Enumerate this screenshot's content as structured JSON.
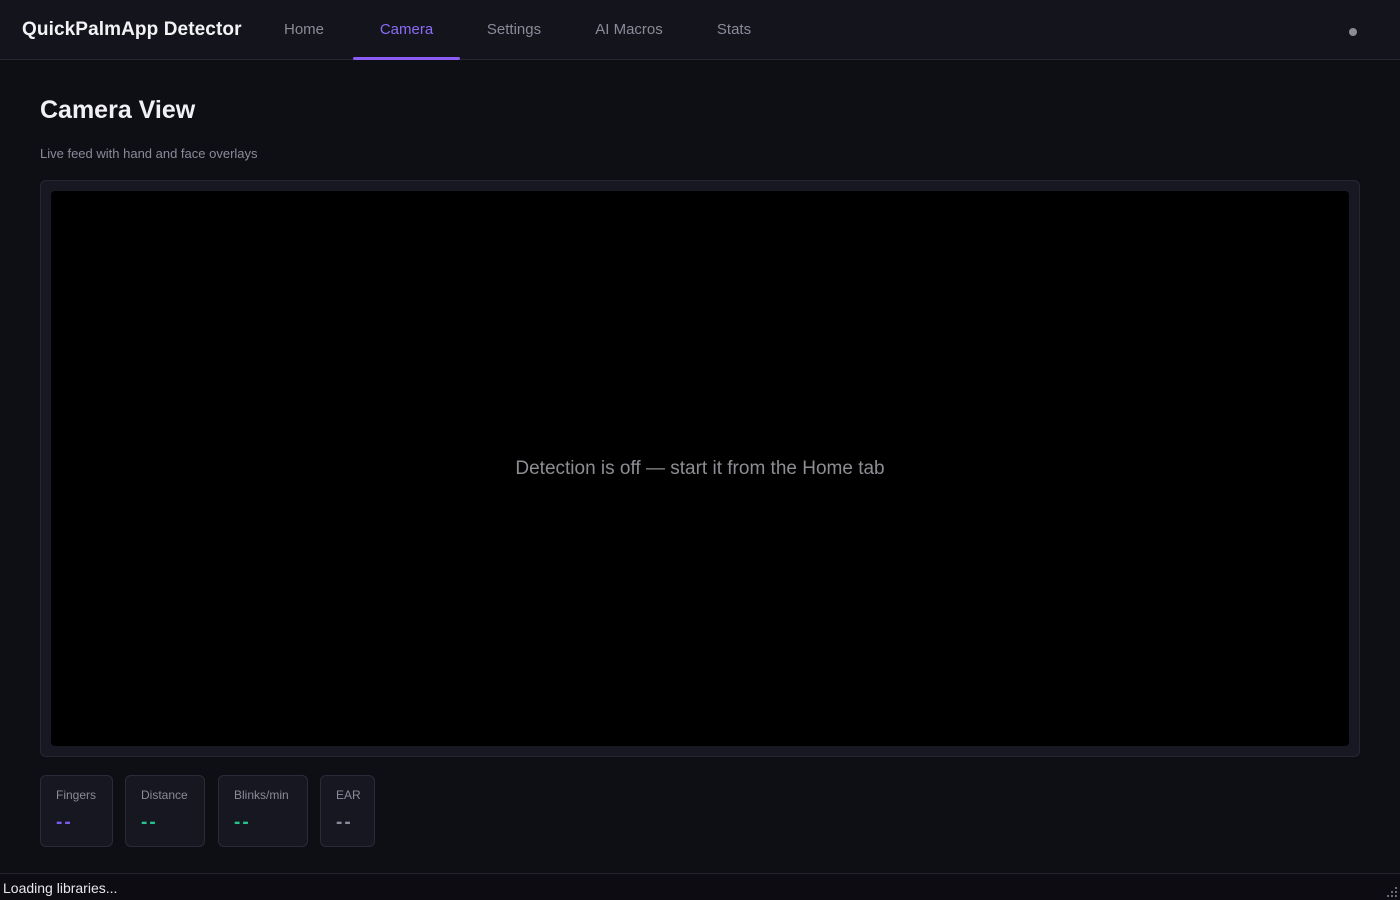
{
  "app": {
    "title": "QuickPalmApp Detector"
  },
  "nav": {
    "tabs": [
      {
        "label": "Home",
        "active": false
      },
      {
        "label": "Camera",
        "active": true
      },
      {
        "label": "Settings",
        "active": false
      },
      {
        "label": "AI Macros",
        "active": false
      },
      {
        "label": "Stats",
        "active": false
      }
    ],
    "status_icon": "status-dot-icon"
  },
  "page": {
    "title": "Camera View",
    "subtitle": "Live feed with hand and face overlays"
  },
  "camera": {
    "message": "Detection is off — start it from the Home tab"
  },
  "stats": [
    {
      "label": "Fingers",
      "value": "--",
      "color": "#7c5cf0"
    },
    {
      "label": "Distance",
      "value": "--",
      "color": "#23c48e"
    },
    {
      "label": "Blinks/min",
      "value": "--",
      "color": "#23c48e"
    },
    {
      "label": "EAR",
      "value": "--",
      "color": "#8a8a99"
    }
  ],
  "status_bar": {
    "text": "Loading libraries...",
    "resize_icon": "resize-grip-icon"
  },
  "colors": {
    "accent": "#8b5cf6",
    "background": "#0e0f15",
    "topbar": "#14141c"
  }
}
